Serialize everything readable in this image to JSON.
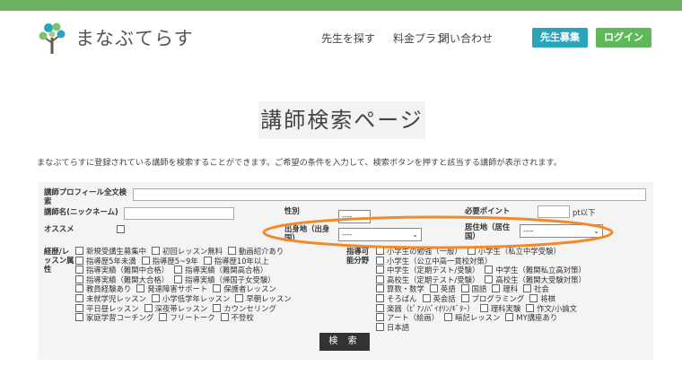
{
  "header": {
    "logo_text": "まなぶてらす",
    "nav": [
      "先生を探す",
      "料金プラン",
      "問い合わせ"
    ],
    "recruit_button": "先生募集",
    "login_button": "ログイン"
  },
  "page_title": "講師検索ページ",
  "description": "まなぶてらすに登録されている講師を検索することができます。ご希望の条件を入力して、検索ボタンを押すと該当する講師が表示されます。",
  "form": {
    "profile_label": "講師プロフィール全文検索",
    "nickname_label": "講師名(ニックネーム)",
    "recommend_label": "オススメ",
    "gender_label": "性別",
    "gender_value": "----",
    "points_label": "必要ポイント",
    "points_suffix": "pt以下",
    "birthplace_label": "出身地（出身国）",
    "birthplace_value": "----",
    "residence_label": "居住地（居住国）",
    "residence_value": "----",
    "career_label": "経歴/レッスン属性",
    "career_options": [
      [
        "新規受講生募集中",
        "初回レッスン無料",
        "動画紹介あり"
      ],
      [
        "指導歴5年未満",
        "指導歴5~9年",
        "指導歴10年以上"
      ],
      [
        "指導実績（難関中合格）",
        "指導実績（難関高合格）"
      ],
      [
        "指導実績（難関大合格）",
        "指導実績（帰国子女受験）"
      ],
      [
        "教員経験あり",
        "発達障害サポート",
        "保護者レッスン"
      ],
      [
        "未就学児レッスン",
        "小学低学年レッスン",
        "早朝レッスン"
      ],
      [
        "平日昼レッスン",
        "深夜帯レッスン",
        "カウンセリング"
      ],
      [
        "家庭学習コーチング",
        "フリートーク",
        "不登校"
      ]
    ],
    "ability_label": "指導可能分野",
    "ability_options": [
      [
        "小学生の勉強（一般）",
        "小学生（私立中学受験）"
      ],
      [
        "小学生（公立中高一貫校対策）"
      ],
      [
        "中学生（定期テスト/受験）",
        "中学生（難関私立高対策）"
      ],
      [
        "高校生（定期テスト/受験）",
        "高校生（難関大受験対策）"
      ],
      [
        "算数・数学",
        "英語",
        "国語",
        "理科",
        "社会"
      ],
      [
        "そろばん",
        "英会話",
        "プログラミング",
        "将棋"
      ],
      [
        "楽器（ﾋﾟｱﾉ/ﾊﾞｲｵﾘﾝ/ｷﾞﾀｰ）",
        "理科実験",
        "作文/小論文"
      ],
      [
        "アート（絵画）",
        "暗記レッスン",
        "MY講座あり"
      ],
      [
        "日本語"
      ]
    ],
    "search_button": "検 索"
  },
  "colors": {
    "top_bar": "#6db25e",
    "recruit_button": "#2aa4b8",
    "login_button": "#5fb85a",
    "highlight_ellipse": "#f08a2a"
  }
}
